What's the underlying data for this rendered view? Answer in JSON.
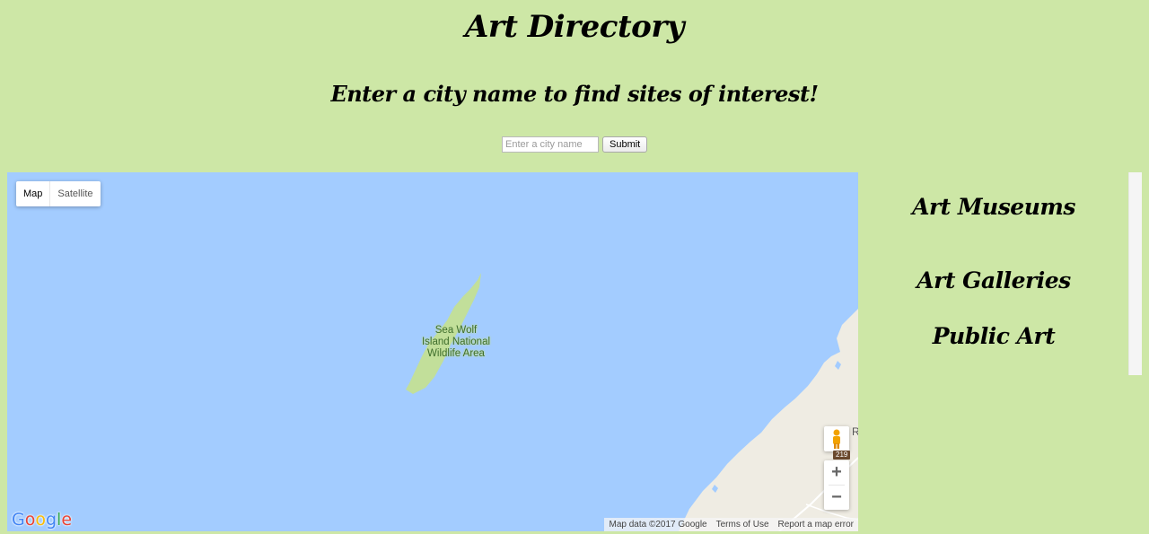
{
  "header": {
    "title": "Art Directory",
    "subtitle": "Enter a city name to find sites of interest!"
  },
  "search": {
    "placeholder": "Enter a city name",
    "value": "",
    "submit_label": "Submit"
  },
  "map": {
    "type_controls": {
      "map": "Map",
      "satellite": "Satellite",
      "selected": "Map"
    },
    "island_label_lines": [
      "Sea Wolf",
      "Island National",
      "Wildlife Area"
    ],
    "road_shield": "219",
    "place_letter": "R",
    "footer": {
      "map_data": "Map data ©2017 Google",
      "terms": "Terms of Use",
      "report": "Report a map error"
    },
    "logo_text": "Google",
    "zoom_in_symbol": "+",
    "zoom_out_symbol": "−",
    "pegman_icon": "pegman-icon"
  },
  "sidebar": {
    "headings": [
      "Art Museums",
      "Art Galleries",
      "Public Art"
    ]
  },
  "colors": {
    "background": "#cde7a6",
    "water": "#a3ccff",
    "land": "#efece3",
    "park": "#c2df9a"
  }
}
